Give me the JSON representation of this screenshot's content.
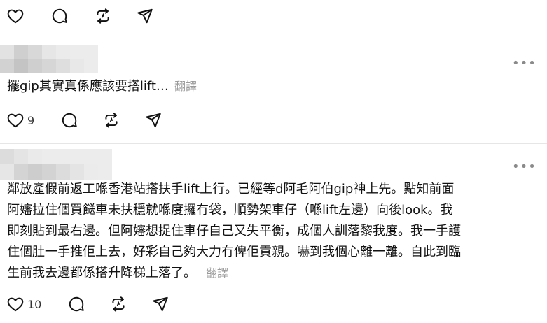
{
  "posts": [
    {
      "text": "",
      "likes": ""
    },
    {
      "text": "擺gip其實真係應該要搭lift…",
      "translate_label": "翻譯",
      "likes": "9"
    },
    {
      "text_lines": [
        "鄰放產假前返工喺香港站搭扶手lift上行。已經等d阿毛阿伯gip神上先。點知前面",
        "阿嬸拉住個買餸車未扶穩就喺度攞冇袋，順勢架車仔（喺lift左邊）向後look。我",
        "即刻貼到最右邊。但阿嬸想捉住車仔自己又失平衡，成個人訓落黎我度。我一手護",
        "住個肚一手推佢上去，好彩自己夠大力冇俾佢貢親。嚇到我個心離一離。自此到臨",
        "生前我去邊都係搭升降梯上落了。"
      ],
      "translate_label": "翻譯",
      "likes": "10"
    }
  ],
  "more_label": "•••",
  "icons": [
    "heart-icon",
    "comment-icon",
    "repost-icon",
    "share-icon"
  ]
}
